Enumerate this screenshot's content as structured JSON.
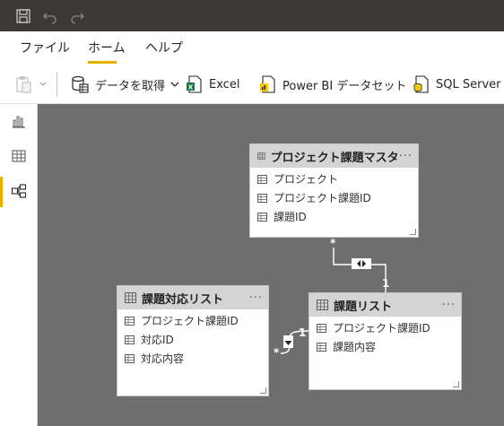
{
  "titlebar": {
    "icons": [
      "save-icon",
      "undo-icon",
      "redo-icon"
    ]
  },
  "tabs": [
    {
      "label": "ファイル"
    },
    {
      "label": "ホーム"
    },
    {
      "label": "ヘルプ"
    }
  ],
  "ribbon": {
    "get_data": "データを取得",
    "excel": "Excel",
    "powerbi": "Power BI データセット",
    "sql": "SQL Server"
  },
  "tables": {
    "master": {
      "title": "プロジェクト課題マスタ",
      "more": "···",
      "fields": [
        "プロジェクト",
        "プロジェクト課題ID",
        "課題ID"
      ]
    },
    "response": {
      "title": "課題対応リスト",
      "more": "···",
      "fields": [
        "プロジェクト課題ID",
        "対応ID",
        "対応内容"
      ]
    },
    "issues": {
      "title": "課題リスト",
      "more": "···",
      "fields": [
        "プロジェクト課題ID",
        "課題内容"
      ]
    }
  },
  "relationships": {
    "r1": {
      "many": "*",
      "one": "1"
    },
    "r2": {
      "many": "*",
      "one": "1"
    }
  }
}
